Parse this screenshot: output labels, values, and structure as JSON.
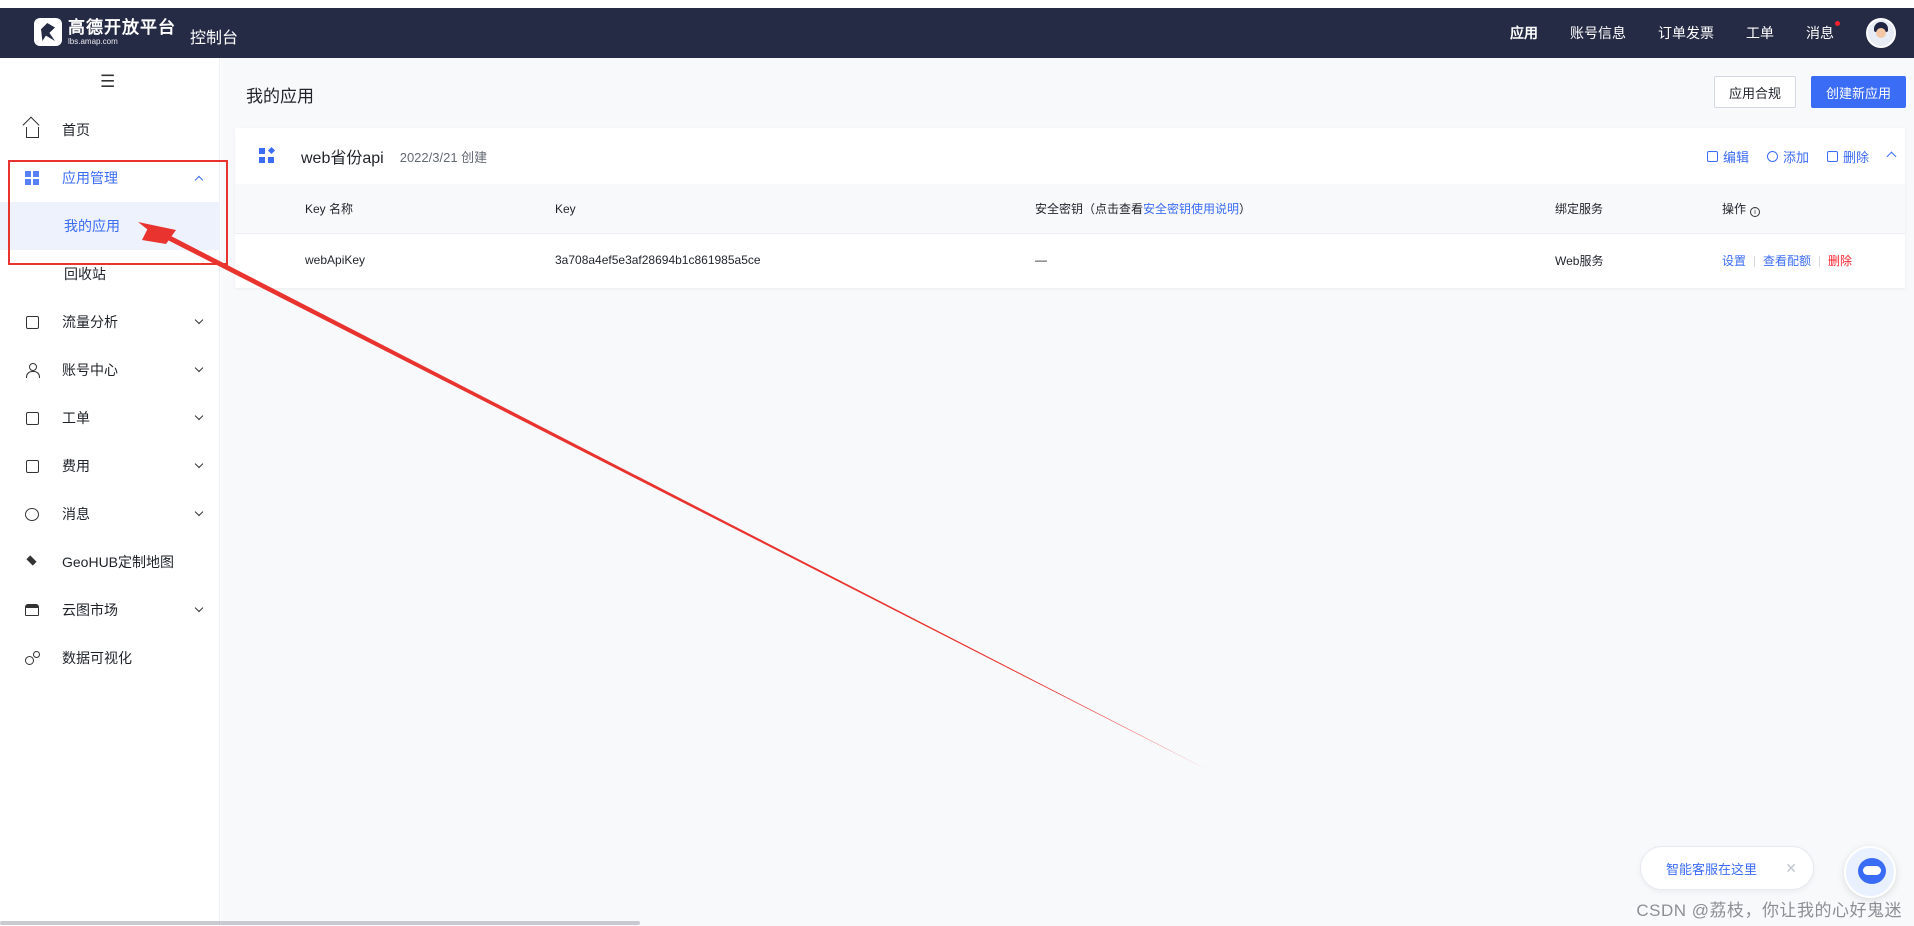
{
  "header": {
    "logo_cn": "高德开放平台",
    "logo_url": "lbs.amap.com",
    "console_title": "控制台",
    "nav": [
      "应用",
      "账号信息",
      "订单发票",
      "工单",
      "消息"
    ]
  },
  "sidebar": {
    "toggle_glyph": "☰",
    "items": [
      {
        "label": "首页",
        "icon": "home-icon"
      },
      {
        "label": "应用管理",
        "icon": "grid-icon"
      },
      {
        "label": "我的应用"
      },
      {
        "label": "回收站"
      },
      {
        "label": "流量分析",
        "icon": "chart-icon"
      },
      {
        "label": "账号中心",
        "icon": "user-icon"
      },
      {
        "label": "工单",
        "icon": "ticket-icon"
      },
      {
        "label": "费用",
        "icon": "yen-icon"
      },
      {
        "label": "消息",
        "icon": "message-icon"
      },
      {
        "label": "GeoHUB定制地图",
        "icon": "layers-icon"
      },
      {
        "label": "云图市场",
        "icon": "store-icon"
      },
      {
        "label": "数据可视化",
        "icon": "visualization-icon"
      }
    ]
  },
  "main": {
    "page_title": "我的应用",
    "compliance_button": "应用合规",
    "create_button": "创建新应用",
    "app": {
      "name": "web省份api",
      "created": "2022/3/21 创建",
      "actions": [
        "编辑",
        "添加",
        "删除"
      ],
      "table": {
        "headers": {
          "key_name": "Key 名称",
          "key": "Key",
          "secret_prefix": "安全密钥（点击查看",
          "secret_link": "安全密钥使用说明",
          "secret_suffix": "）",
          "service": "绑定服务",
          "ops": "操作"
        },
        "rows": [
          {
            "key_name": "webApiKey",
            "key": "3a708a4ef5e3af28694b1c861985a5ce",
            "secret": "—",
            "service": "Web服务",
            "ops": [
              "设置",
              "查看配额",
              "删除"
            ]
          }
        ]
      }
    }
  },
  "help": {
    "label": "智能客服在这里",
    "close": "✕"
  },
  "watermark": "CSDN @荔枝，你让我的心好鬼迷",
  "colors": {
    "topbar": "#252a45",
    "accent": "#3b6cf6",
    "danger": "#f5222d",
    "annotation": "#e8332f"
  }
}
